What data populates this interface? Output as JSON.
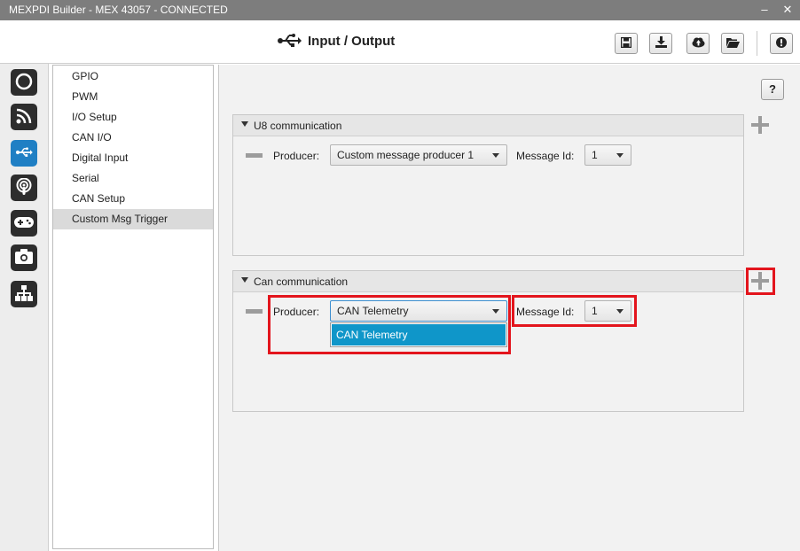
{
  "window": {
    "title": "MEXPDI Builder - MEX 43057 - CONNECTED",
    "minimize": "–",
    "close": "✕"
  },
  "header": {
    "title": "Input / Output",
    "icon": "usb-icon",
    "toolbar": [
      "save-icon",
      "download-icon",
      "cloud-upload-icon",
      "open-folder-icon",
      "info-icon"
    ]
  },
  "left_nav": [
    "power-icon",
    "rss-icon",
    "usb-icon",
    "podcast-icon",
    "gamepad-icon",
    "camera-icon",
    "sitemap-icon"
  ],
  "sub_nav": {
    "items": [
      "GPIO",
      "PWM",
      "I/O Setup",
      "CAN I/O",
      "Digital Input",
      "Serial",
      "CAN Setup",
      "Custom Msg Trigger"
    ],
    "selected": "Custom Msg Trigger"
  },
  "help_label": "?",
  "u8_panel": {
    "title": "U8 communication",
    "producer_label": "Producer:",
    "producer_value": "Custom message producer 1",
    "message_id_label": "Message Id:",
    "message_id_value": "1"
  },
  "can_panel": {
    "title": "Can communication",
    "producer_label": "Producer:",
    "producer_value": "CAN Telemetry",
    "producer_options": [
      "CAN Telemetry"
    ],
    "message_id_label": "Message Id:",
    "message_id_value": "1"
  },
  "colors": {
    "accent": "#1f7fc4",
    "highlight": "#e3151d",
    "dropdown_selected": "#0f96c9"
  }
}
